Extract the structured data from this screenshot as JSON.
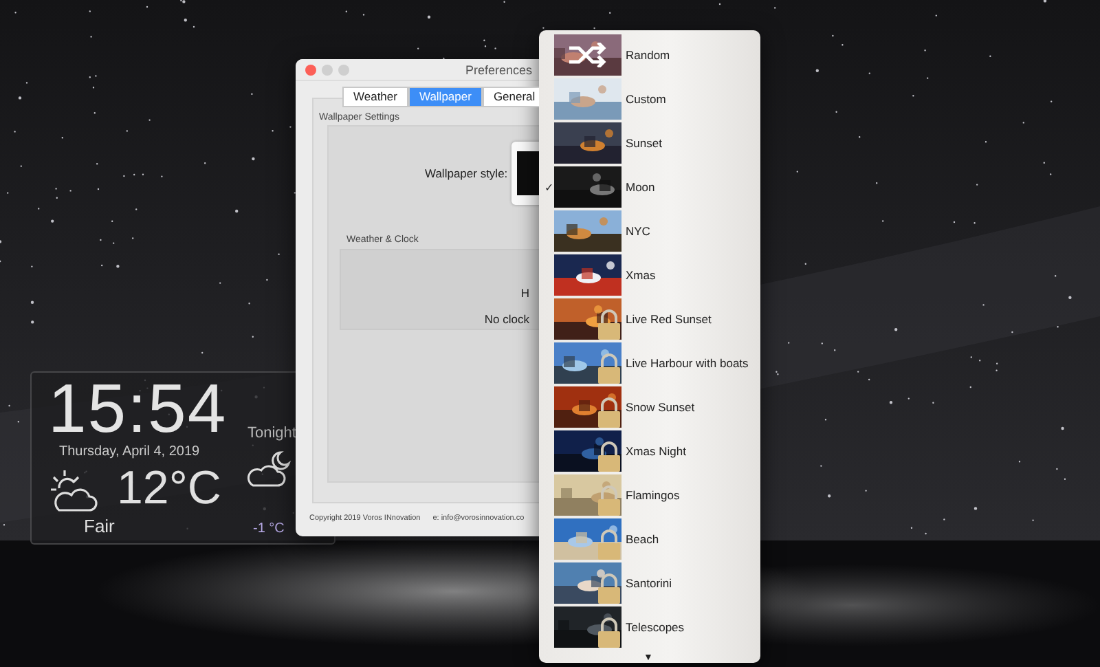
{
  "widget": {
    "time": "15:54",
    "date": "Thursday, April 4, 2019",
    "temperature": "12°C",
    "condition": "Fair",
    "tonight": {
      "label": "Tonight",
      "temperature": "-1 °C"
    }
  },
  "window": {
    "title": "Preferences",
    "tabs": [
      {
        "label": "Weather",
        "selected": false
      },
      {
        "label": "Wallpaper",
        "selected": true
      },
      {
        "label": "General",
        "selected": false
      }
    ],
    "wallpaper_settings": {
      "heading": "Wallpaper Settings",
      "style_label": "Wallpaper style:"
    },
    "weather_clock": {
      "heading": "Weather & Clock",
      "line_1": "H",
      "line_2": "No clock"
    },
    "footer": {
      "copyright": "Copyright 2019 Voros INnovation",
      "email": "e: info@vorosinnovation.co"
    }
  },
  "menu": {
    "items": [
      {
        "label": "Random",
        "kind": "shuffle",
        "selected": false,
        "locked": false
      },
      {
        "label": "Custom",
        "kind": "picture",
        "selected": false,
        "locked": false
      },
      {
        "label": "Sunset",
        "kind": "picture",
        "selected": false,
        "locked": false
      },
      {
        "label": "Moon",
        "kind": "picture",
        "selected": true,
        "locked": false
      },
      {
        "label": "NYC",
        "kind": "picture",
        "selected": false,
        "locked": false
      },
      {
        "label": "Xmas",
        "kind": "picture",
        "selected": false,
        "locked": false
      },
      {
        "label": "Live Red Sunset",
        "kind": "picture",
        "selected": false,
        "locked": true
      },
      {
        "label": "Live Harbour with boats",
        "kind": "picture",
        "selected": false,
        "locked": true
      },
      {
        "label": "Snow Sunset",
        "kind": "picture",
        "selected": false,
        "locked": true
      },
      {
        "label": "Xmas Night",
        "kind": "picture",
        "selected": false,
        "locked": true
      },
      {
        "label": "Flamingos",
        "kind": "picture",
        "selected": false,
        "locked": true
      },
      {
        "label": "Beach",
        "kind": "picture",
        "selected": false,
        "locked": true
      },
      {
        "label": "Santorini",
        "kind": "picture",
        "selected": false,
        "locked": true
      },
      {
        "label": "Telescopes",
        "kind": "picture",
        "selected": false,
        "locked": true
      }
    ],
    "check_mark": "✓",
    "scroll_arrow": "▼"
  }
}
